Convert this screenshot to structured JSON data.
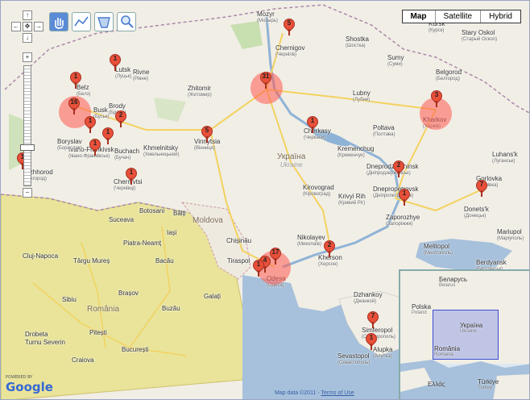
{
  "map_type": {
    "map": "Map",
    "satellite": "Satellite",
    "hybrid": "Hybrid"
  },
  "attribution": {
    "text": "Map data ©2011 -",
    "terms": "Terms of Use"
  },
  "logo": {
    "powered_by": "POWERED BY",
    "name": "Google"
  },
  "countries": [
    {
      "name": "Україна",
      "sub": "Ukraine"
    },
    {
      "name": "România",
      "sub": ""
    },
    {
      "name": "Moldova",
      "sub": ""
    }
  ],
  "cities": [
    {
      "name": "Lutsk",
      "sub": "(Луцьк)"
    },
    {
      "name": "Rivne",
      "sub": "(Рівне)"
    },
    {
      "name": "Zhitomir",
      "sub": "(Житомир)"
    },
    {
      "name": "Mozyr",
      "sub": "(Мозырь)"
    },
    {
      "name": "Chernigov",
      "sub": "(Чернігів)"
    },
    {
      "name": "Shostka",
      "sub": "(Шостка)"
    },
    {
      "name": "Kursk",
      "sub": "(Курск)"
    },
    {
      "name": "Stary Oskol",
      "sub": "(Старый Оскол)"
    },
    {
      "name": "Sumy",
      "sub": "(Суми)"
    },
    {
      "name": "Belgorod",
      "sub": "(Белгород)"
    },
    {
      "name": "Kharkov",
      "sub": "(Харків)"
    },
    {
      "name": "Lubny",
      "sub": "(Лубни)"
    },
    {
      "name": "Poltava",
      "sub": "(Полтава)"
    },
    {
      "name": "Cherkasy",
      "sub": "(Черкаси)"
    },
    {
      "name": "Kremenchug",
      "sub": "(Кременчук)"
    },
    {
      "name": "Dneprodzerzhinsk",
      "sub": "(Дніпродзержинськ)"
    },
    {
      "name": "Dnepropetrovsk",
      "sub": "(Дніпропетровськ)"
    },
    {
      "name": "Zaporozhye",
      "sub": "(Запоріжжя)"
    },
    {
      "name": "Donets'k",
      "sub": "(Донецьк)"
    },
    {
      "name": "Gorlovka",
      "sub": "(Горлівка)"
    },
    {
      "name": "Luhans'k",
      "sub": "(Луганськ)"
    },
    {
      "name": "Kirovograd",
      "sub": "(Кіровоград)"
    },
    {
      "name": "Krivyi Rih",
      "sub": "(Кривий Ріг)"
    },
    {
      "name": "Vinnytsia",
      "sub": "(Вінниця)"
    },
    {
      "name": "Khmelnitsky",
      "sub": "(Хмельницький)"
    },
    {
      "name": "Chernivtsi",
      "sub": "(Чернівці)"
    },
    {
      "name": "Ivano-Frankivsk",
      "sub": "(Івано-Франківськ)"
    },
    {
      "name": "Buchach",
      "sub": "(Бучач)"
    },
    {
      "name": "Brody",
      "sub": "(Броди)"
    },
    {
      "name": "Busk",
      "sub": "(Буськ)"
    },
    {
      "name": "Belz",
      "sub": "(Белз)"
    },
    {
      "name": "Boryslav",
      "sub": "(Борислав)"
    },
    {
      "name": "Uzhhorod",
      "sub": "(Ужгород)"
    },
    {
      "name": "Nikolayev",
      "sub": "(Миколаїв)"
    },
    {
      "name": "Kherson",
      "sub": "(Херсон)"
    },
    {
      "name": "Tiraspol",
      "sub": ""
    },
    {
      "name": "Chișinău",
      "sub": ""
    },
    {
      "name": "Bălți",
      "sub": ""
    },
    {
      "name": "Botosani",
      "sub": ""
    },
    {
      "name": "Suceava",
      "sub": ""
    },
    {
      "name": "Iași",
      "sub": ""
    },
    {
      "name": "Piatra-Neamț",
      "sub": ""
    },
    {
      "name": "Bacău",
      "sub": ""
    },
    {
      "name": "Cluj-Napoca",
      "sub": ""
    },
    {
      "name": "Târgu Mureș",
      "sub": ""
    },
    {
      "name": "Sibiu",
      "sub": ""
    },
    {
      "name": "Brașov",
      "sub": ""
    },
    {
      "name": "Buzău",
      "sub": ""
    },
    {
      "name": "Galați",
      "sub": ""
    },
    {
      "name": "Pitești",
      "sub": ""
    },
    {
      "name": "București",
      "sub": ""
    },
    {
      "name": "Craiova",
      "sub": ""
    },
    {
      "name": "Drobeta",
      "sub": ""
    },
    {
      "name": "Turnu Severin",
      "sub": ""
    },
    {
      "name": "Simferopol",
      "sub": "(Сімферополь)"
    },
    {
      "name": "Sevastopol",
      "sub": "(Севастополь)"
    },
    {
      "name": "Alupka",
      "sub": "(Алупка)"
    },
    {
      "name": "Melitopol",
      "sub": "(Мелітополь)"
    },
    {
      "name": "Mariupol",
      "sub": "(Маріуполь)"
    },
    {
      "name": "Berdyansk",
      "sub": "(Бердянськ)"
    },
    {
      "name": "Odesa",
      "sub": "(Одеса)"
    },
    {
      "name": "Dzhankoy",
      "sub": "(Джанкой)"
    }
  ],
  "markers": [
    {
      "label": "1"
    },
    {
      "label": "1"
    },
    {
      "label": "16"
    },
    {
      "label": "1"
    },
    {
      "label": "2"
    },
    {
      "label": "1"
    },
    {
      "label": "1"
    },
    {
      "label": "1"
    },
    {
      "label": "1"
    },
    {
      "label": "5"
    },
    {
      "label": "31"
    },
    {
      "label": "5"
    },
    {
      "label": "1"
    },
    {
      "label": "3"
    },
    {
      "label": "2"
    },
    {
      "label": "1"
    },
    {
      "label": "7"
    },
    {
      "label": "17"
    },
    {
      "label": "4"
    },
    {
      "label": "2"
    },
    {
      "label": "7"
    },
    {
      "label": "1"
    },
    {
      "label": "1"
    }
  ],
  "overview": {
    "labels": [
      {
        "name": "Беларусь",
        "sub": "Belarus"
      },
      {
        "name": "Polska",
        "sub": "Poland"
      },
      {
        "name": "Україна",
        "sub": "Ukraine"
      },
      {
        "name": "România",
        "sub": "Romania"
      },
      {
        "name": "Ελλάς",
        "sub": ""
      },
      {
        "name": "Türkiye",
        "sub": "Turkey"
      }
    ]
  },
  "colors": {
    "marker": "#e8503a",
    "cluster": "rgba(255,90,80,0.55)",
    "water": "#a7c1dc",
    "romania": "#e9e49a",
    "road": "#f3d25f"
  },
  "icons": [
    "pan-up-icon",
    "pan-left-icon",
    "pan-center-icon",
    "pan-right-icon",
    "pan-down-icon",
    "zoom-in-icon",
    "zoom-out-icon",
    "hand-tool-icon",
    "line-tool-icon",
    "polygon-tool-icon",
    "search-tool-icon"
  ]
}
